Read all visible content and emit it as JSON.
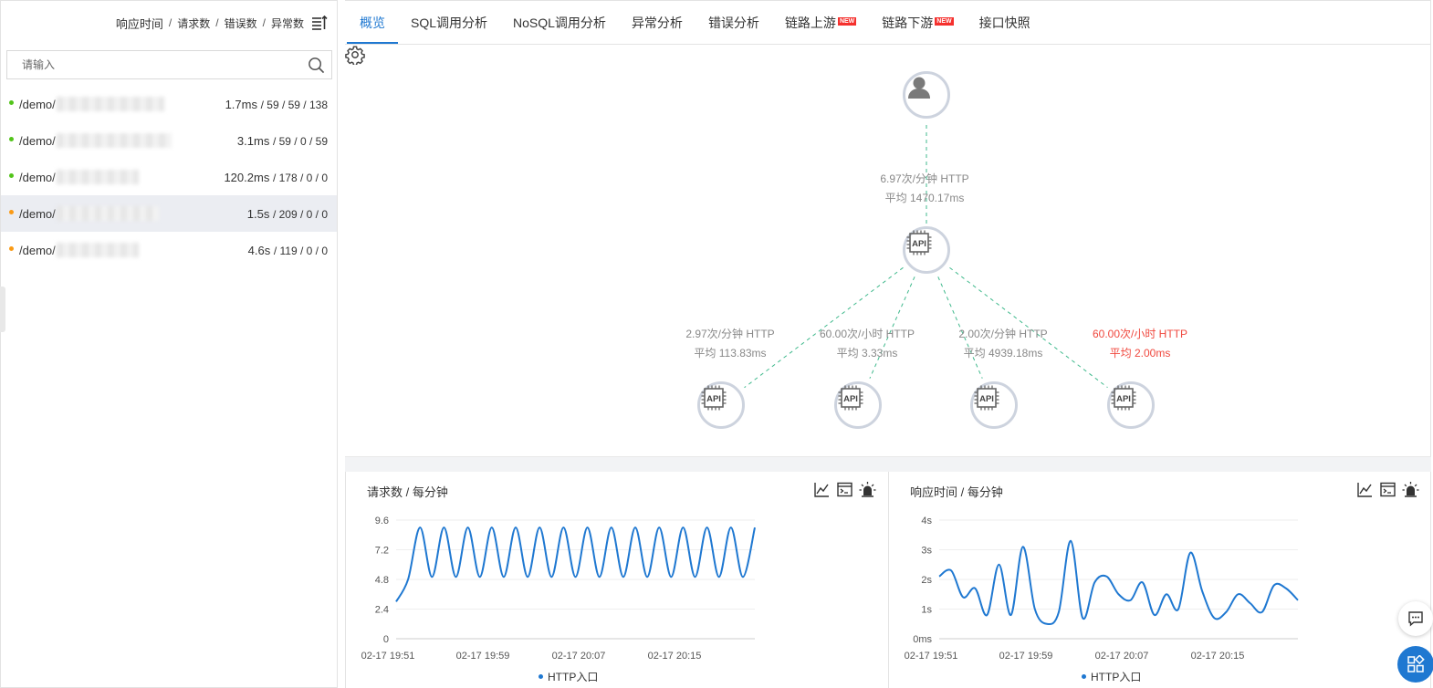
{
  "sort_bar": {
    "items": [
      "响应时间",
      "请求数",
      "错误数",
      "异常数"
    ],
    "separator": "/"
  },
  "search": {
    "placeholder": "请输入",
    "value": ""
  },
  "endpoints": [
    {
      "path": "/demo/",
      "time": "1.7ms",
      "counts": "/ 59 / 59 / 138",
      "status_color": "#52c41a",
      "selected": false
    },
    {
      "path": "/demo/",
      "time": "3.1ms",
      "counts": "/ 59 / 0 / 59",
      "status_color": "#52c41a",
      "selected": false
    },
    {
      "path": "/demo/",
      "time": "120.2ms",
      "counts": "/ 178 / 0 / 0",
      "status_color": "#52c41a",
      "selected": false
    },
    {
      "path": "/demo/",
      "time": "1.5s",
      "counts": "/ 209 / 0 / 0",
      "status_color": "#fa9a15",
      "selected": true
    },
    {
      "path": "/demo/",
      "time": "4.6s",
      "counts": "/ 119 / 0 / 0",
      "status_color": "#fa9a15",
      "selected": false
    }
  ],
  "tabs": [
    {
      "label": "概览",
      "active": true,
      "new": false
    },
    {
      "label": "SQL调用分析",
      "active": false,
      "new": false
    },
    {
      "label": "NoSQL调用分析",
      "active": false,
      "new": false
    },
    {
      "label": "异常分析",
      "active": false,
      "new": false
    },
    {
      "label": "错误分析",
      "active": false,
      "new": false
    },
    {
      "label": "链路上游",
      "active": false,
      "new": true
    },
    {
      "label": "链路下游",
      "active": false,
      "new": true
    },
    {
      "label": "接口快照",
      "active": false,
      "new": false
    }
  ],
  "new_badge": "NEW",
  "topology": {
    "api_label": "API",
    "upstream_edge": {
      "line1": "6.97次/分钟 HTTP",
      "line2": "平均 1470.17ms",
      "error": false
    },
    "downstream_edges": [
      {
        "line1": "2.97次/分钟 HTTP",
        "line2": "平均 113.83ms",
        "error": false
      },
      {
        "line1": "60.00次/小时 HTTP",
        "line2": "平均 3.33ms",
        "error": false
      },
      {
        "line1": "2.00次/分钟 HTTP",
        "line2": "平均 4939.18ms",
        "error": false
      },
      {
        "line1": "60.00次/小时 HTTP",
        "line2": "平均 2.00ms",
        "error": true
      }
    ],
    "edge_color": "#3fb98c",
    "error_color": "#f0483e"
  },
  "chart_data": [
    {
      "type": "line",
      "title": "请求数 / 每分钟",
      "x_ticks": [
        "02-17 19:51",
        "02-17 19:59",
        "02-17 20:07",
        "02-17 20:15"
      ],
      "y_ticks": [
        "9.6",
        "7.2",
        "4.8",
        "2.4",
        "0"
      ],
      "ylim": [
        0,
        9.6
      ],
      "series": [
        {
          "name": "HTTP入口",
          "color": "#1f78d1",
          "values": [
            3,
            4.8,
            9,
            5,
            9,
            5,
            9,
            5,
            9,
            5,
            9,
            5,
            9,
            5,
            9,
            5,
            9,
            5,
            9,
            5,
            9,
            5,
            9,
            5,
            9,
            5,
            9,
            5,
            9,
            5,
            9
          ]
        }
      ]
    },
    {
      "type": "line",
      "title": "响应时间 / 每分钟",
      "x_ticks": [
        "02-17 19:51",
        "02-17 19:59",
        "02-17 20:07",
        "02-17 20:15"
      ],
      "y_ticks": [
        "4s",
        "3s",
        "2s",
        "1s",
        "0ms"
      ],
      "ylim": [
        0,
        4
      ],
      "series": [
        {
          "name": "HTTP入口",
          "color": "#1f78d1",
          "values": [
            2.1,
            2.3,
            1.4,
            1.7,
            0.8,
            2.5,
            0.8,
            3.1,
            1.0,
            0.5,
            0.9,
            3.3,
            0.7,
            1.9,
            2.1,
            1.5,
            1.3,
            1.9,
            0.8,
            1.5,
            1.0,
            2.9,
            1.6,
            0.7,
            0.9,
            1.5,
            1.2,
            0.9,
            1.8,
            1.7,
            1.3
          ]
        }
      ]
    }
  ]
}
